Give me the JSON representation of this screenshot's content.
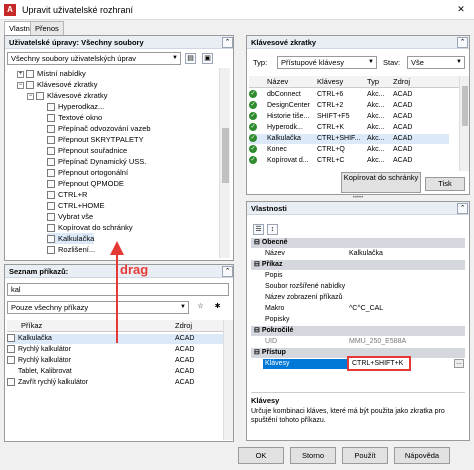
{
  "window": {
    "title": "Upravit uživatelské rozhraní",
    "tabs": [
      "Vlastní",
      "Přenos"
    ]
  },
  "customizations": {
    "header": "Uživatelské úpravy: Všechny soubory",
    "dropdown_value": "Všechny soubory uživatelských úprav",
    "tree": [
      {
        "label": "Místní nabídky",
        "level": 1,
        "expander": "+"
      },
      {
        "label": "Klávesové zkratky",
        "level": 1,
        "expander": "-"
      },
      {
        "label": "Klávesové zkratky",
        "level": 2,
        "expander": "-"
      },
      {
        "label": "Hyperodkaz...",
        "level": 3
      },
      {
        "label": "Textové okno",
        "level": 3
      },
      {
        "label": "Přepínač odvozování vazeb",
        "level": 3
      },
      {
        "label": "Přepnout SKRYTPALETY",
        "level": 3
      },
      {
        "label": "Přepnout souřadnice",
        "level": 3
      },
      {
        "label": "Přepínač Dynamický USS.",
        "level": 3
      },
      {
        "label": "Přepnout ortogonální",
        "level": 3
      },
      {
        "label": "Přepnout QPMODE",
        "level": 3
      },
      {
        "label": "CTRL+R",
        "level": 3
      },
      {
        "label": "CTRL+HOME",
        "level": 3
      },
      {
        "label": "Vybrat vše",
        "level": 3
      },
      {
        "label": "Kopírovat do schránky",
        "level": 3
      },
      {
        "label": "Kalkulačka",
        "level": 3
      },
      {
        "label": "Rozlišení...",
        "level": 3
      }
    ]
  },
  "command_list": {
    "header": "Seznam příkazů:",
    "search_value": "kal",
    "filter_value": "Pouze všechny příkazy",
    "columns": [
      "Příkaz",
      "Zdroj"
    ],
    "rows": [
      {
        "name": "Kalkulačka",
        "source": "ACAD"
      },
      {
        "name": "Rychlý kalkulátor",
        "source": "ACAD"
      },
      {
        "name": "Rychlý kalkulátor",
        "source": "ACAD"
      },
      {
        "name": "Tablet, Kalibrovat",
        "source": "ACAD"
      },
      {
        "name": "Zavřít rychlý kalkulátor",
        "source": "ACAD"
      }
    ],
    "drag_annotation": "drag",
    "annotation_color": "#e53935"
  },
  "shortcuts": {
    "header": "Klávesové zkratky",
    "type_label": "Typ:",
    "type_value": "Přístupové klávesy",
    "state_label": "Stav:",
    "state_value": "Vše",
    "columns": [
      "Název",
      "Klávesy",
      "Typ",
      "Zdroj"
    ],
    "rows": [
      {
        "name": "dbConnect",
        "keys": "CTRL+6",
        "type": "Akc...",
        "source": "ACAD"
      },
      {
        "name": "DesignCenter",
        "keys": "CTRL+2",
        "type": "Akc...",
        "source": "ACAD"
      },
      {
        "name": "Historie tiše...",
        "keys": "SHIFT+F5",
        "type": "Akc...",
        "source": "ACAD"
      },
      {
        "name": "Hyperodk...",
        "keys": "CTRL+K",
        "type": "Akc...",
        "source": "ACAD"
      },
      {
        "name": "Kalkulačka",
        "keys": "CTRL+SHIF...",
        "type": "Akc...",
        "source": "ACAD"
      },
      {
        "name": "Konec",
        "keys": "CTRL+Q",
        "type": "Akc...",
        "source": "ACAD"
      },
      {
        "name": "Kopírovat d...",
        "keys": "CTRL+C",
        "type": "Akc...",
        "source": "ACAD"
      }
    ],
    "copy_button": "Kopírovat do schránky",
    "print_button": "Tisk"
  },
  "properties": {
    "header": "Vlastnosti",
    "categories": {
      "general": "Obecné",
      "command": "Příkaz",
      "advanced": "Pokročilé",
      "access": "Přístup"
    },
    "rows": {
      "name": {
        "label": "Název",
        "value": "Kalkulačka"
      },
      "description": {
        "label": "Popis",
        "value": ""
      },
      "context_menu_file": {
        "label": "Soubor rozšířené nabídky",
        "value": ""
      },
      "display_name": {
        "label": "Název zobrazení příkazů",
        "value": ""
      },
      "macro": {
        "label": "Makro",
        "value": "^C^C_CAL"
      },
      "tags": {
        "label": "Popisky",
        "value": ""
      },
      "id": {
        "label": "UID",
        "value": "MMU_250_E588A"
      },
      "keys": {
        "label": "Klávesy",
        "value": "CTRL+SHIFT+K"
      }
    },
    "help_title": "Klávesy",
    "help_text": "Určuje kombinaci kláves, které má být použita jako zkratka pro spuštění tohoto příkazu.",
    "selection_color": "#0078d7",
    "highlight_border_color": "#e53935"
  },
  "footer": {
    "ok": "OK",
    "cancel": "Storno",
    "apply": "Použít",
    "help": "Nápověda"
  }
}
